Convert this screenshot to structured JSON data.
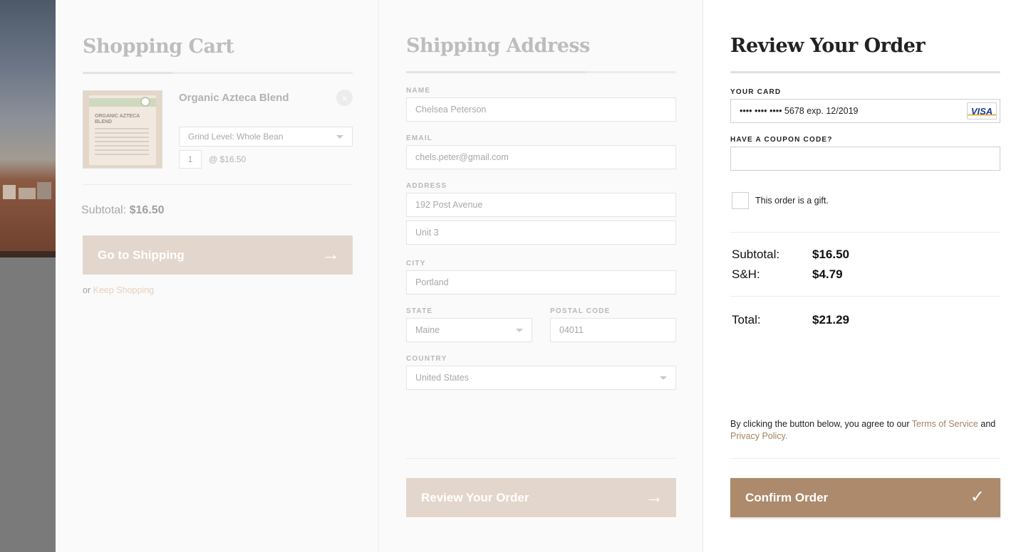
{
  "cart": {
    "title": "Shopping Cart",
    "product_name": "Organic Azteca Blend",
    "product_image_text": "ORGANIC AZTECA BLEND",
    "remove_icon": "×",
    "grind_select": "Grind Level: Whole Bean",
    "quantity": "1",
    "unit_price": "@   $16.50",
    "subtotal_label": "Subtotal:",
    "subtotal_value": "$16.50",
    "cta_label": "Go to Shipping",
    "arrow_icon": "→",
    "keep_prefix": "or",
    "keep_link": "Keep Shopping"
  },
  "shipping": {
    "title": "Shipping Address",
    "name_label": "NAME",
    "name_value": "Chelsea Peterson",
    "email_label": "EMAIL",
    "email_value": "chels.peter@gmail.com",
    "address_label": "ADDRESS",
    "address1_value": "192 Post Avenue",
    "address2_value": "Unit 3",
    "city_label": "CITY",
    "city_value": "Portland",
    "state_label": "STATE",
    "state_value": "Maine",
    "postal_label": "POSTAL CODE",
    "postal_value": "04011",
    "country_label": "COUNTRY",
    "country_value": "United States",
    "cta_label": "Review Your Order",
    "arrow_icon": "→"
  },
  "review": {
    "title": "Review Your Order",
    "card_label": "YOUR CARD",
    "card_value": "•••• •••• •••• 5678   exp. 12/2019",
    "card_brand": "VISA",
    "coupon_label": "HAVE A COUPON CODE?",
    "gift_label": "This order is a gift.",
    "subtotal_label": "Subtotal:",
    "subtotal_value": "$16.50",
    "sh_label": "S&H:",
    "sh_value": "$4.79",
    "total_label": "Total:",
    "total_value": "$21.29",
    "terms_prefix": "By clicking the button below, you agree to our",
    "terms_link": "Terms of Service",
    "terms_and": "and",
    "privacy_link": "Privacy Policy.",
    "cta_label": "Confirm Order",
    "check_icon": "✓"
  },
  "colors": {
    "accent": "#ad8a6c",
    "accent_light": "#e3d6cc",
    "link": "#a5825f"
  }
}
